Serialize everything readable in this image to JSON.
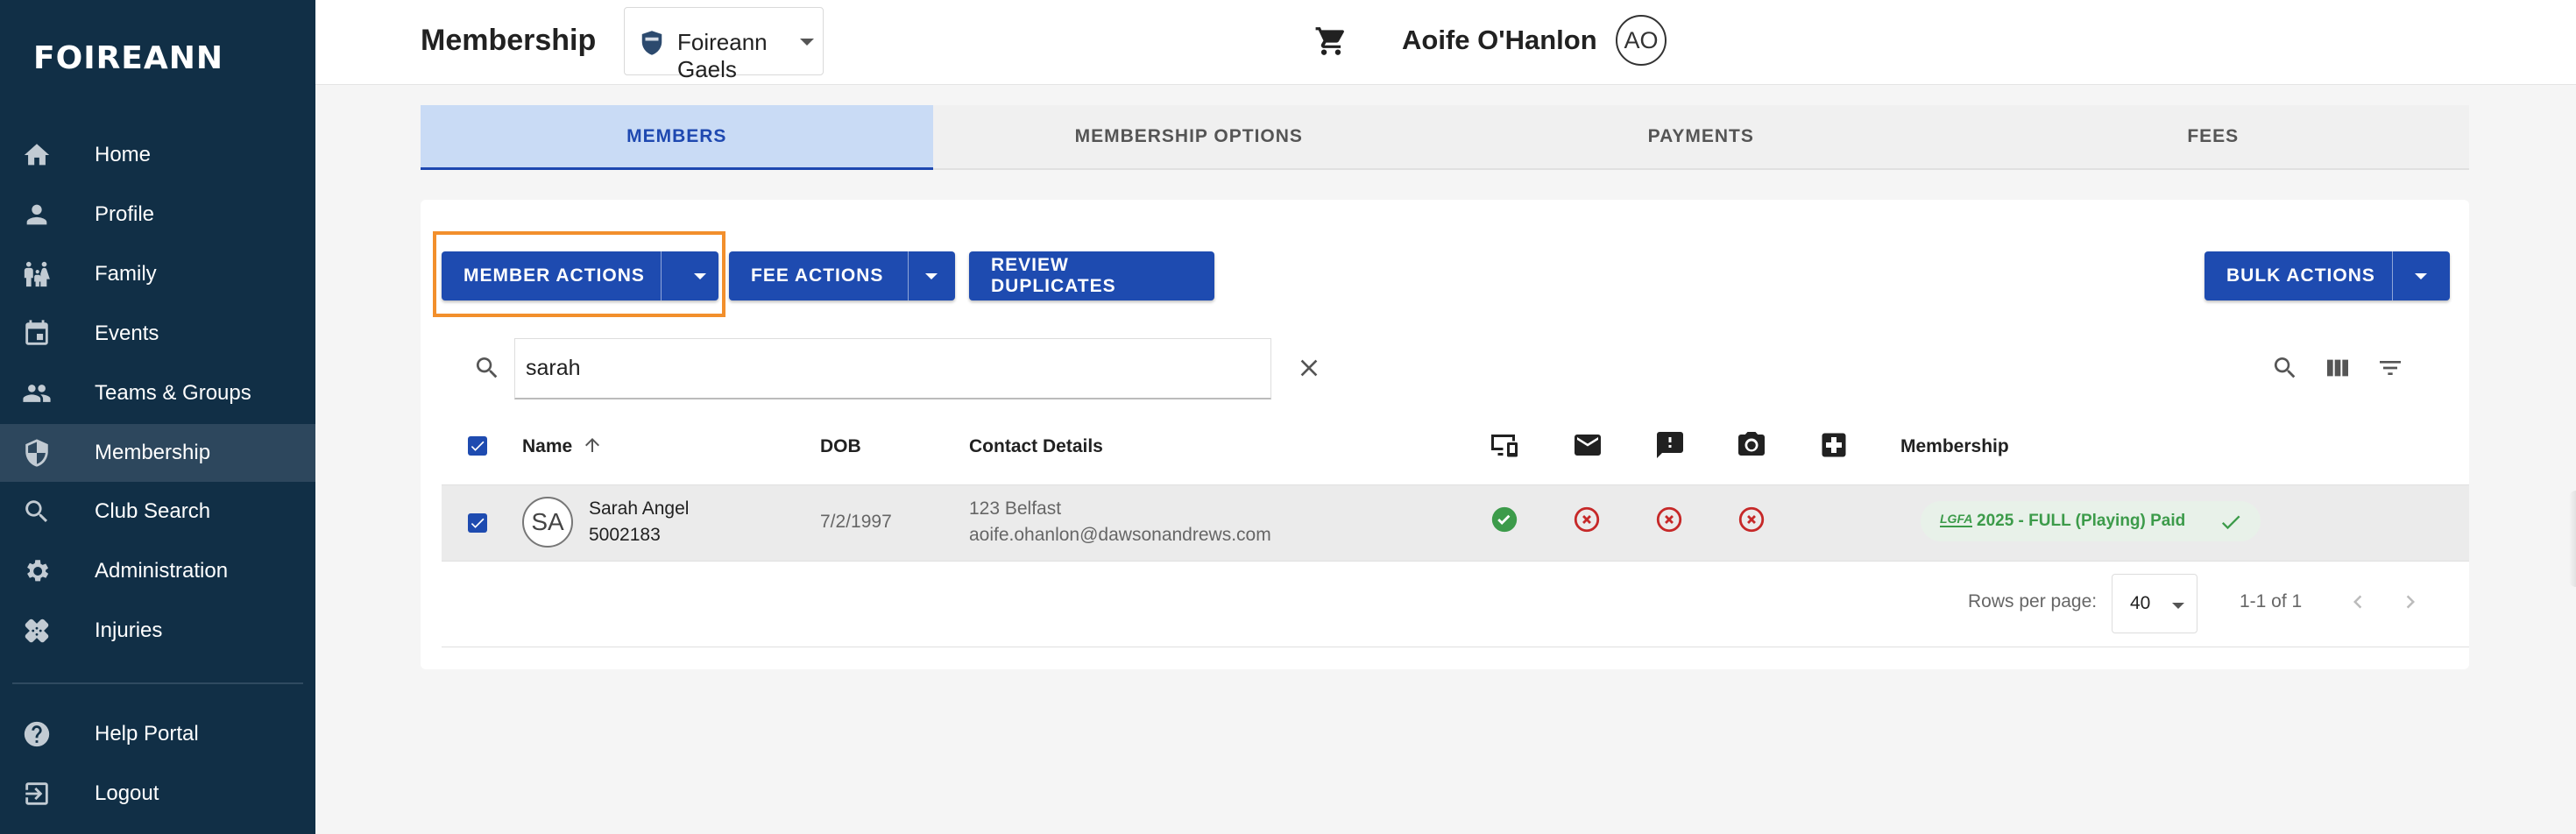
{
  "brand": {
    "logo_text": "FOIREANN"
  },
  "sidebar": {
    "items": [
      {
        "label": "Home",
        "icon": "home-icon"
      },
      {
        "label": "Profile",
        "icon": "person-icon"
      },
      {
        "label": "Family",
        "icon": "family-icon"
      },
      {
        "label": "Events",
        "icon": "calendar-icon"
      },
      {
        "label": "Teams & Groups",
        "icon": "group-icon"
      },
      {
        "label": "Membership",
        "icon": "shield-icon",
        "active": true
      },
      {
        "label": "Club Search",
        "icon": "search-icon"
      },
      {
        "label": "Administration",
        "icon": "gear-icon"
      },
      {
        "label": "Injuries",
        "icon": "bandage-icon"
      }
    ],
    "bottom_items": [
      {
        "label": "Help Portal",
        "icon": "help-icon"
      },
      {
        "label": "Logout",
        "icon": "logout-icon"
      }
    ]
  },
  "header": {
    "title": "Membership",
    "club_select": {
      "value": "Foireann Gaels"
    },
    "user_name": "Aoife O'Hanlon",
    "user_initials": "AO"
  },
  "tabs": [
    {
      "label": "MEMBERS",
      "active": true
    },
    {
      "label": "MEMBERSHIP OPTIONS"
    },
    {
      "label": "PAYMENTS"
    },
    {
      "label": "FEES"
    }
  ],
  "toolbar": {
    "member_actions": "MEMBER ACTIONS",
    "fee_actions": "FEE ACTIONS",
    "review_duplicates": "REVIEW DUPLICATES",
    "bulk_actions": "BULK ACTIONS"
  },
  "search": {
    "value": "sarah"
  },
  "table": {
    "columns": {
      "name": "Name",
      "dob": "DOB",
      "contact": "Contact Details",
      "membership": "Membership"
    },
    "icon_columns": [
      "devices-icon",
      "email-icon",
      "feedback-icon",
      "camera-icon",
      "medical-icon"
    ],
    "rows": [
      {
        "initials": "SA",
        "name": "Sarah Angel",
        "member_id": "5002183",
        "dob": "7/2/1997",
        "address": "123 Belfast",
        "email": "aoife.ohanlon@dawsonandrews.com",
        "statuses": [
          "check",
          "cross",
          "cross",
          "cross"
        ],
        "membership": {
          "logo": "LGFA",
          "label": "2025 - FULL (Playing) Paid"
        }
      }
    ]
  },
  "pagination": {
    "rows_per_page_label": "Rows per page:",
    "rows_per_page": "40",
    "range": "1-1 of 1"
  },
  "colors": {
    "sidebar_bg": "#112f46",
    "primary": "#1e4bb0",
    "success": "#3c9b4a",
    "error": "#c62828",
    "highlight": "#f28f2c"
  }
}
